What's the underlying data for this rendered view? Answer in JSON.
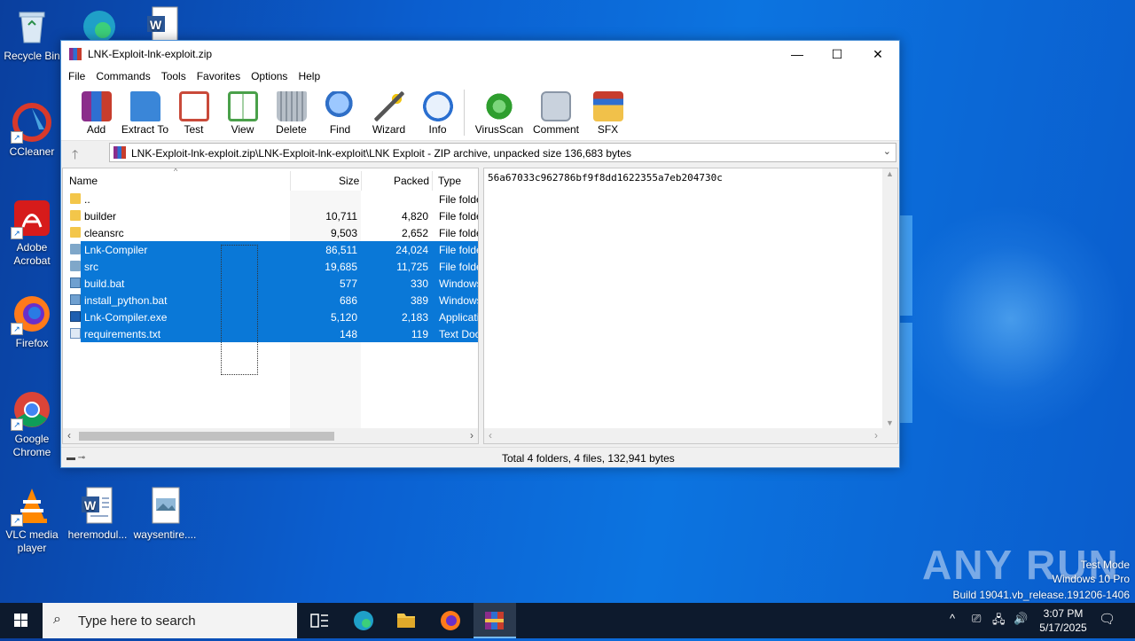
{
  "desktop": {
    "icons": [
      {
        "label": "Recycle Bin"
      },
      {
        "label": "CCleaner"
      },
      {
        "label": "Adobe Acrobat"
      },
      {
        "label": "Firefox"
      },
      {
        "label": "Google Chrome"
      },
      {
        "label": "VLC media player"
      },
      {
        "label": "heremodul..."
      },
      {
        "label": "waysentire...."
      }
    ]
  },
  "window": {
    "title": "LNK-Exploit-lnk-exploit.zip",
    "controls": {
      "minimize": "—",
      "maximize": "☐",
      "close": "✕"
    },
    "menu": [
      "File",
      "Commands",
      "Tools",
      "Favorites",
      "Options",
      "Help"
    ],
    "toolbar": [
      {
        "label": "Add",
        "icon": "add-icon",
        "color": "#c0392b"
      },
      {
        "label": "Extract To",
        "icon": "extract-folder-icon",
        "color": "#3a86d8"
      },
      {
        "label": "Test",
        "icon": "test-clipboard-icon",
        "color": "#c94a3a"
      },
      {
        "label": "View",
        "icon": "view-book-icon",
        "color": "#4aa04a"
      },
      {
        "label": "Delete",
        "icon": "delete-trash-icon",
        "color": "#9aa3ad"
      },
      {
        "label": "Find",
        "icon": "find-magnifier-icon",
        "color": "#2f6fc7"
      },
      {
        "label": "Wizard",
        "icon": "wizard-wand-icon",
        "color": "#8e44ad"
      },
      {
        "label": "Info",
        "icon": "info-icon",
        "color": "#2a6fd0"
      },
      {
        "label": "VirusScan",
        "icon": "virusscan-bug-icon",
        "color": "#2e9e2e"
      },
      {
        "label": "Comment",
        "icon": "comment-icon",
        "color": "#8a96a6"
      },
      {
        "label": "SFX",
        "icon": "sfx-box-icon",
        "color": "#d98a2a"
      }
    ],
    "address": "LNK-Exploit-lnk-exploit.zip\\LNK-Exploit-lnk-exploit\\LNK Exploit - ZIP archive, unpacked size 136,683 bytes",
    "columns": {
      "name": "Name",
      "size": "Size",
      "packed": "Packed",
      "type": "Type"
    },
    "files": [
      {
        "name": "..",
        "size": "",
        "packed": "",
        "type": "File folder",
        "kind": "folder",
        "selected": false
      },
      {
        "name": "builder",
        "size": "10,711",
        "packed": "4,820",
        "type": "File folder",
        "kind": "folder",
        "selected": false
      },
      {
        "name": "cleansrc",
        "size": "9,503",
        "packed": "2,652",
        "type": "File folder",
        "kind": "folder",
        "selected": false
      },
      {
        "name": "Lnk-Compiler",
        "size": "86,511",
        "packed": "24,024",
        "type": "File folder",
        "kind": "folder",
        "selected": true
      },
      {
        "name": "src",
        "size": "19,685",
        "packed": "11,725",
        "type": "File folder",
        "kind": "folder",
        "selected": true
      },
      {
        "name": "build.bat",
        "size": "577",
        "packed": "330",
        "type": "Windows Batch File",
        "kind": "bat",
        "selected": true
      },
      {
        "name": "install_python.bat",
        "size": "686",
        "packed": "389",
        "type": "Windows Batch File",
        "kind": "bat",
        "selected": true
      },
      {
        "name": "Lnk-Compiler.exe",
        "size": "5,120",
        "packed": "2,183",
        "type": "Application",
        "kind": "exe",
        "selected": true
      },
      {
        "name": "requirements.txt",
        "size": "148",
        "packed": "119",
        "type": "Text Document",
        "kind": "txt",
        "selected": true
      }
    ],
    "comment": "56a67033c962786bf9f8dd1622355a7eb204730c",
    "status": "Total 4 folders, 4 files, 132,941 bytes"
  },
  "watermark": {
    "logo": "ANY RUN",
    "mode": "Test Mode",
    "os": "Windows 10 Pro",
    "build": "Build 19041.vb_release.191206-1406"
  },
  "taskbar": {
    "search_placeholder": "Type here to search",
    "time": "3:07 PM",
    "date": "5/17/2025"
  }
}
